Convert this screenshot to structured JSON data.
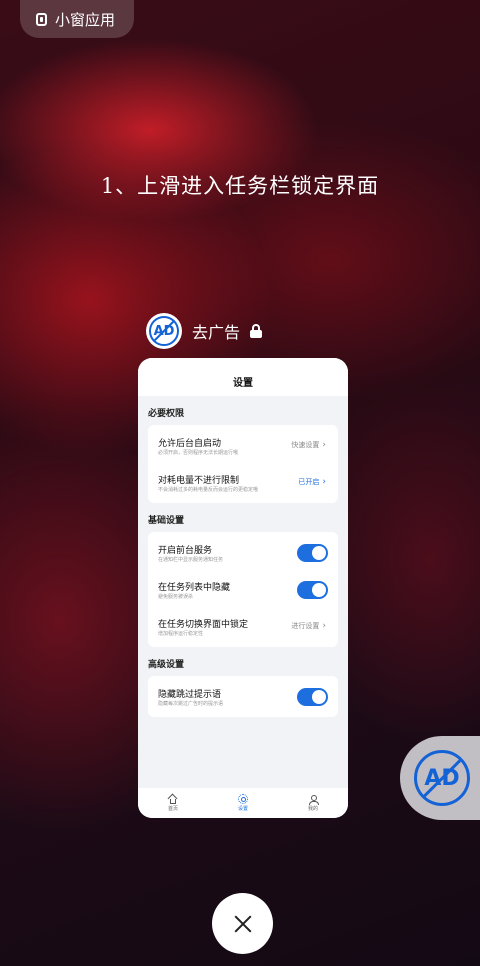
{
  "mini_window": {
    "label": "小窗应用"
  },
  "headline": "1、上滑进入任务栏锁定界面",
  "recent_app": {
    "name": "去广告",
    "logo_text": "AD"
  },
  "settings_screen": {
    "title": "设置",
    "sections": [
      {
        "title": "必要权限",
        "rows": [
          {
            "label": "允许后台自启动",
            "sub": "必须开启，否则程序无法长期运行哦",
            "right": "快速设置"
          },
          {
            "label": "对耗电量不进行限制",
            "sub": "不会消耗过多的耗电量反而会运行的更稳定哦",
            "right": "已开启"
          }
        ]
      },
      {
        "title": "基础设置",
        "rows": [
          {
            "label": "开启前台服务",
            "sub": "在通知栏中显示服务通知任务"
          },
          {
            "label": "在任务列表中隐藏",
            "sub": "避免服务被误杀"
          },
          {
            "label": "在任务切换界面中锁定",
            "sub": "增加程序运行稳定性",
            "right": "进行设置"
          }
        ]
      },
      {
        "title": "高级设置",
        "rows": [
          {
            "label": "隐藏跳过提示语",
            "sub": "隐藏每次跳过广告时的提示语"
          }
        ]
      }
    ],
    "nav": [
      {
        "label": "首页",
        "icon": "home-icon"
      },
      {
        "label": "设置",
        "icon": "settings-icon",
        "active": true
      },
      {
        "label": "我的",
        "icon": "user-icon"
      }
    ]
  },
  "floating_button": {
    "logo_text": "AD"
  },
  "colors": {
    "accent": "#1d6fe0",
    "logo_blue": "#1463d6"
  }
}
